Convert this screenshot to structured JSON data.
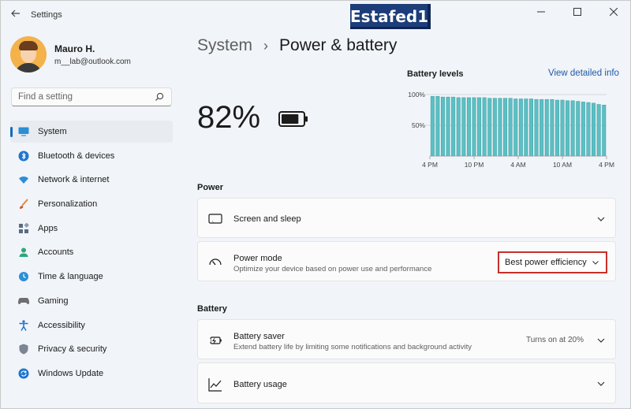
{
  "window": {
    "title": "Settings",
    "watermark": "Estafed1",
    "controls": [
      "minimize",
      "maximize",
      "close"
    ]
  },
  "profile": {
    "name": "Mauro H.",
    "email": "m__lab@outlook.com"
  },
  "search": {
    "placeholder": "Find a setting"
  },
  "sidebar": {
    "items": [
      {
        "label": "System",
        "icon": "system-icon",
        "active": true
      },
      {
        "label": "Bluetooth & devices",
        "icon": "bluetooth-icon"
      },
      {
        "label": "Network & internet",
        "icon": "wifi-icon"
      },
      {
        "label": "Personalization",
        "icon": "brush-icon"
      },
      {
        "label": "Apps",
        "icon": "apps-icon"
      },
      {
        "label": "Accounts",
        "icon": "person-icon"
      },
      {
        "label": "Time & language",
        "icon": "globe-clock-icon"
      },
      {
        "label": "Gaming",
        "icon": "gamepad-icon"
      },
      {
        "label": "Accessibility",
        "icon": "accessibility-icon"
      },
      {
        "label": "Privacy & security",
        "icon": "shield-icon"
      },
      {
        "label": "Windows Update",
        "icon": "update-icon"
      }
    ]
  },
  "breadcrumb": {
    "parent": "System",
    "separator": "›",
    "current": "Power & battery"
  },
  "battery": {
    "percent_text": "82%",
    "level": 0.82
  },
  "battery_levels": {
    "title": "Battery levels",
    "link": "View detailed info",
    "chart_data": {
      "type": "bar",
      "ylabel_ticks": [
        "100%",
        "50%"
      ],
      "x_ticks": [
        "4 PM",
        "10 PM",
        "4 AM",
        "10 AM",
        "4 PM"
      ],
      "ylim": [
        0,
        100
      ],
      "values": [
        97,
        97,
        96,
        96,
        96,
        95,
        95,
        95,
        95,
        95,
        95,
        94,
        94,
        94,
        94,
        94,
        93,
        93,
        93,
        93,
        92,
        92,
        92,
        92,
        91,
        91,
        90,
        90,
        89,
        88,
        87,
        86,
        84,
        83
      ],
      "bar_color": "#5cbfc3",
      "grid": true
    }
  },
  "sections": {
    "power": "Power",
    "battery": "Battery"
  },
  "cards": {
    "screen_sleep": {
      "title": "Screen and sleep"
    },
    "power_mode": {
      "title": "Power mode",
      "subtitle": "Optimize your device based on power use and performance",
      "selected": "Best power efficiency"
    },
    "battery_saver": {
      "title": "Battery saver",
      "subtitle": "Extend battery life by limiting some notifications and background activity",
      "status": "Turns on at 20%"
    },
    "battery_usage": {
      "title": "Battery usage"
    }
  },
  "colors": {
    "accent": "#0f6cbd",
    "highlight_border": "#c7302a",
    "watermark_bg": "#1c3d7a"
  }
}
